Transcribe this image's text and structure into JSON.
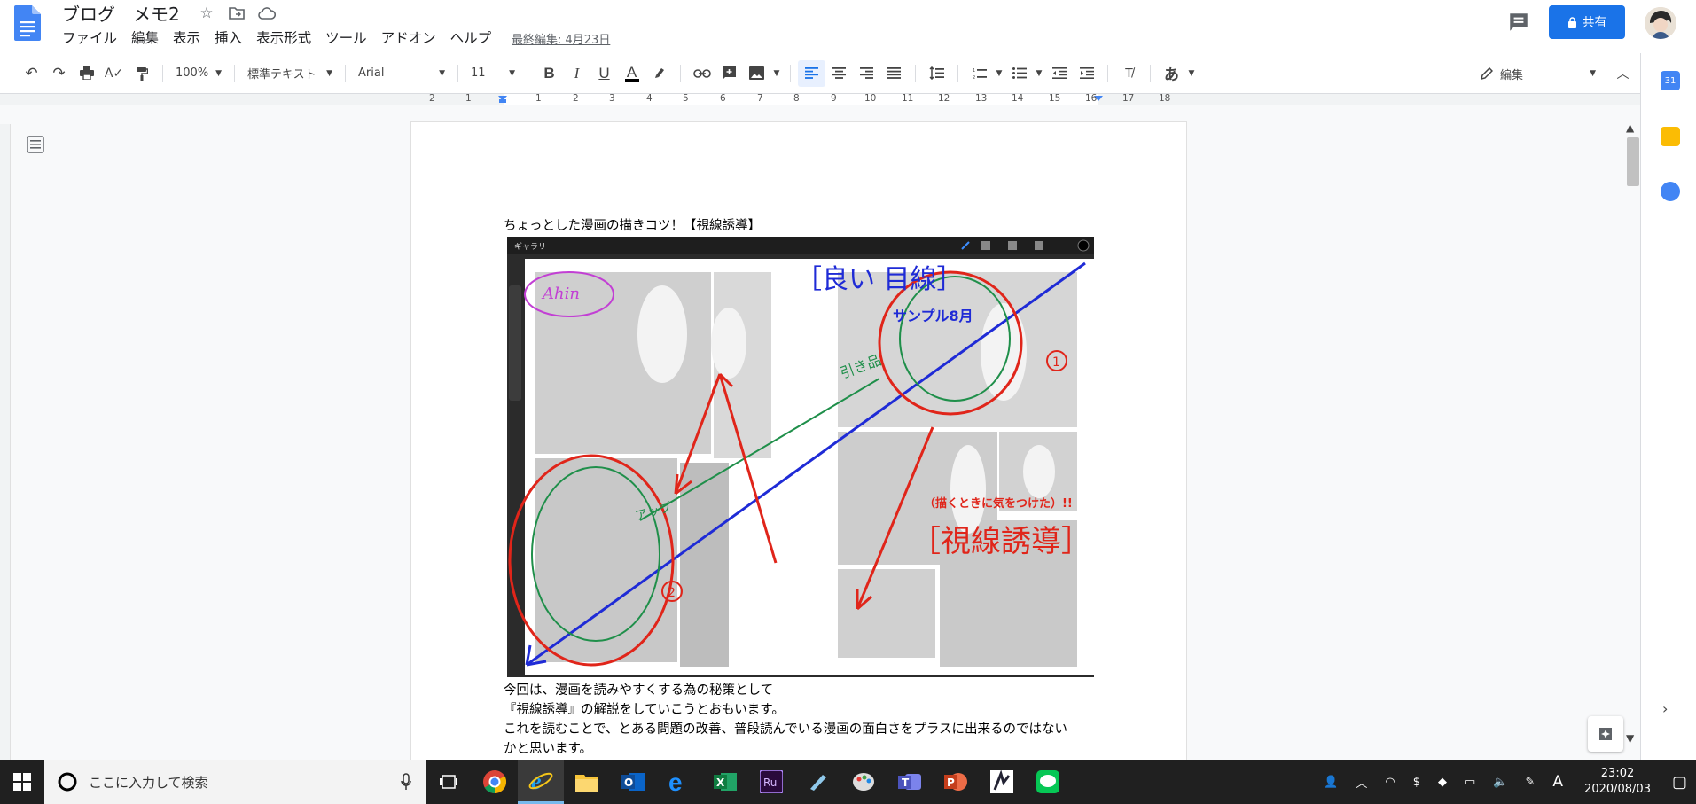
{
  "header": {
    "doc_title": "ブログ　メモ2",
    "menu": [
      "ファイル",
      "編集",
      "表示",
      "挿入",
      "表示形式",
      "ツール",
      "アドオン",
      "ヘルプ"
    ],
    "last_edit": "最終編集: 4月23日",
    "share_label": "共有"
  },
  "toolbar": {
    "zoom": "100%",
    "style": "標準テキスト",
    "font": "Arial",
    "size": "11",
    "mode": "編集",
    "input_mode": "あ"
  },
  "ruler": [
    "2",
    "1",
    "1",
    "2",
    "3",
    "4",
    "5",
    "6",
    "7",
    "8",
    "9",
    "10",
    "11",
    "12",
    "13",
    "14",
    "15",
    "16",
    "17",
    "18"
  ],
  "document": {
    "heading": "ちょっとした漫画の描きコツ！【視線誘導】",
    "paragraphs": [
      "今回は、漫画を読みやすくする為の秘策として",
      "『視線誘導』の解説をしていこうとおもいます。",
      "これを読むことで、とある問題の改善、普段読んでいる漫画の面白さをプラスに出来るのではない",
      "かと思います。"
    ],
    "image": {
      "app_menu": "ギャラリー",
      "good_eye": "［良い 目線］",
      "sample": "サンプル8月",
      "pull": "引き品",
      "up": "アップ",
      "note": "（描くときに気をつけた）!!",
      "title": "［視線誘導］",
      "n1": "1",
      "n2": "2"
    }
  },
  "taskbar": {
    "search_placeholder": "ここに入力して検索",
    "time": "23:02",
    "date": "2020/08/03",
    "ime": "A"
  }
}
